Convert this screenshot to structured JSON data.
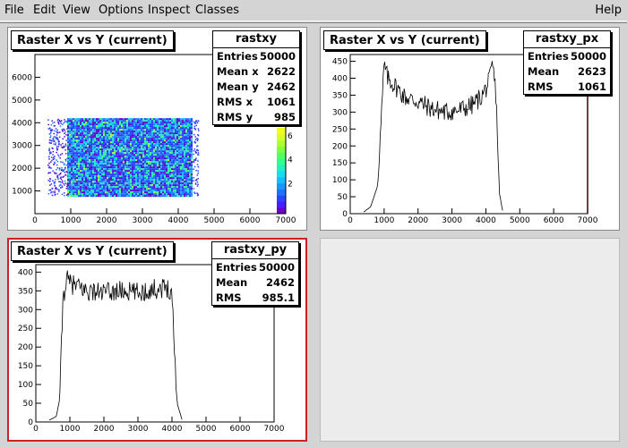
{
  "menu": {
    "file": "File",
    "edit": "Edit",
    "view": "View",
    "options": "Options",
    "inspect": "Inspect",
    "classes": "Classes",
    "help": "Help"
  },
  "pads": [
    {
      "title": "Raster X vs Y (current)",
      "stats": {
        "name": "rastxy",
        "rows": [
          {
            "label": "Entries",
            "value": "50000"
          },
          {
            "label": "Mean x",
            "value": "2622"
          },
          {
            "label": "Mean y",
            "value": "2462"
          },
          {
            "label": "RMS x",
            "value": "1061"
          },
          {
            "label": "RMS y",
            "value": "985"
          }
        ]
      }
    },
    {
      "title": "Raster X vs Y (current)",
      "stats": {
        "name": "rastxy_px",
        "rows": [
          {
            "label": "Entries",
            "value": "50000"
          },
          {
            "label": "Mean",
            "value": "2623"
          },
          {
            "label": "RMS",
            "value": "1061"
          }
        ]
      }
    },
    {
      "title": "Raster X vs Y (current)",
      "stats": {
        "name": "rastxy_py",
        "rows": [
          {
            "label": "Entries",
            "value": "50000"
          },
          {
            "label": "Mean",
            "value": "2462"
          },
          {
            "label": "RMS",
            "value": "985.1"
          }
        ]
      }
    }
  ],
  "chart_data": [
    {
      "type": "heatmap",
      "xlim": [
        0,
        7000
      ],
      "ylim": [
        0,
        7000
      ],
      "x_ticks": [
        "0",
        "1000",
        "2000",
        "3000",
        "4000",
        "5000",
        "6000",
        "7000"
      ],
      "y_ticks": [
        "1000",
        "2000",
        "3000",
        "4000",
        "5000",
        "6000"
      ],
      "colorbar_ticks": [
        "2",
        "4",
        "6"
      ],
      "region_x": [
        900,
        4400
      ],
      "region_y": [
        800,
        4200
      ]
    },
    {
      "type": "line",
      "xlim": [
        0,
        7000
      ],
      "ylim": [
        0,
        470
      ],
      "x_ticks": [
        "0",
        "1000",
        "2000",
        "3000",
        "4000",
        "5000",
        "6000",
        "7000"
      ],
      "y_ticks": [
        "0",
        "50",
        "100",
        "150",
        "200",
        "250",
        "300",
        "350",
        "400",
        "450"
      ],
      "x": [
        400,
        600,
        800,
        900,
        1000,
        1100,
        1300,
        1600,
        2000,
        2400,
        2800,
        3200,
        3600,
        3900,
        4100,
        4200,
        4300,
        4400,
        4500
      ],
      "y": [
        5,
        20,
        80,
        250,
        440,
        400,
        380,
        345,
        330,
        310,
        300,
        305,
        320,
        350,
        390,
        440,
        350,
        60,
        5
      ]
    },
    {
      "type": "line",
      "xlim": [
        0,
        7000
      ],
      "ylim": [
        0,
        420
      ],
      "x_ticks": [
        "0",
        "1000",
        "2000",
        "3000",
        "4000",
        "5000",
        "6000",
        "7000"
      ],
      "y_ticks": [
        "0",
        "50",
        "100",
        "150",
        "200",
        "250",
        "300",
        "350",
        "400"
      ],
      "x": [
        400,
        600,
        700,
        800,
        900,
        1000,
        1500,
        2000,
        2500,
        3000,
        3500,
        3900,
        4000,
        4150,
        4300
      ],
      "y": [
        5,
        15,
        60,
        330,
        380,
        370,
        350,
        345,
        350,
        345,
        355,
        360,
        340,
        50,
        5
      ]
    }
  ]
}
